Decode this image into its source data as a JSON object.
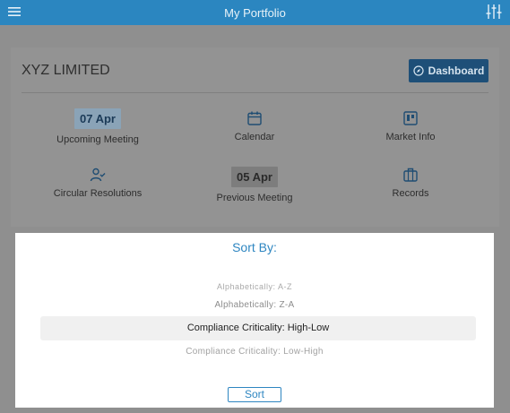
{
  "header": {
    "title": "My Portfolio",
    "menu_icon": "hamburger-menu-icon",
    "filter_icon": "sliders-icon"
  },
  "company": {
    "name": "XYZ LIMITED",
    "dashboard_label": "Dashboard"
  },
  "tiles": {
    "upcoming_meeting": {
      "date": "07 Apr",
      "label": "Upcoming Meeting"
    },
    "calendar": {
      "label": "Calendar",
      "icon": "calendar-icon"
    },
    "market_info": {
      "label": "Market Info",
      "icon": "market-info-icon"
    },
    "circular_resolutions": {
      "label": "Circular Resolutions",
      "icon": "user-check-icon"
    },
    "previous_meeting": {
      "date": "05 Apr",
      "label": "Previous Meeting"
    },
    "records": {
      "label": "Records",
      "icon": "briefcase-icon"
    }
  },
  "sort_sheet": {
    "title": "Sort By:",
    "options": [
      "Alphabetically: A-Z",
      "Alphabetically: Z-A",
      "Compliance Criticality: High-Low",
      "Compliance Criticality: Low-High"
    ],
    "selected": "Compliance Criticality: High-Low",
    "button_label": "Sort"
  },
  "colors": {
    "accent": "#2e86c1",
    "topbar": "#2b86c0",
    "dashboard_button": "#1e4f78"
  }
}
